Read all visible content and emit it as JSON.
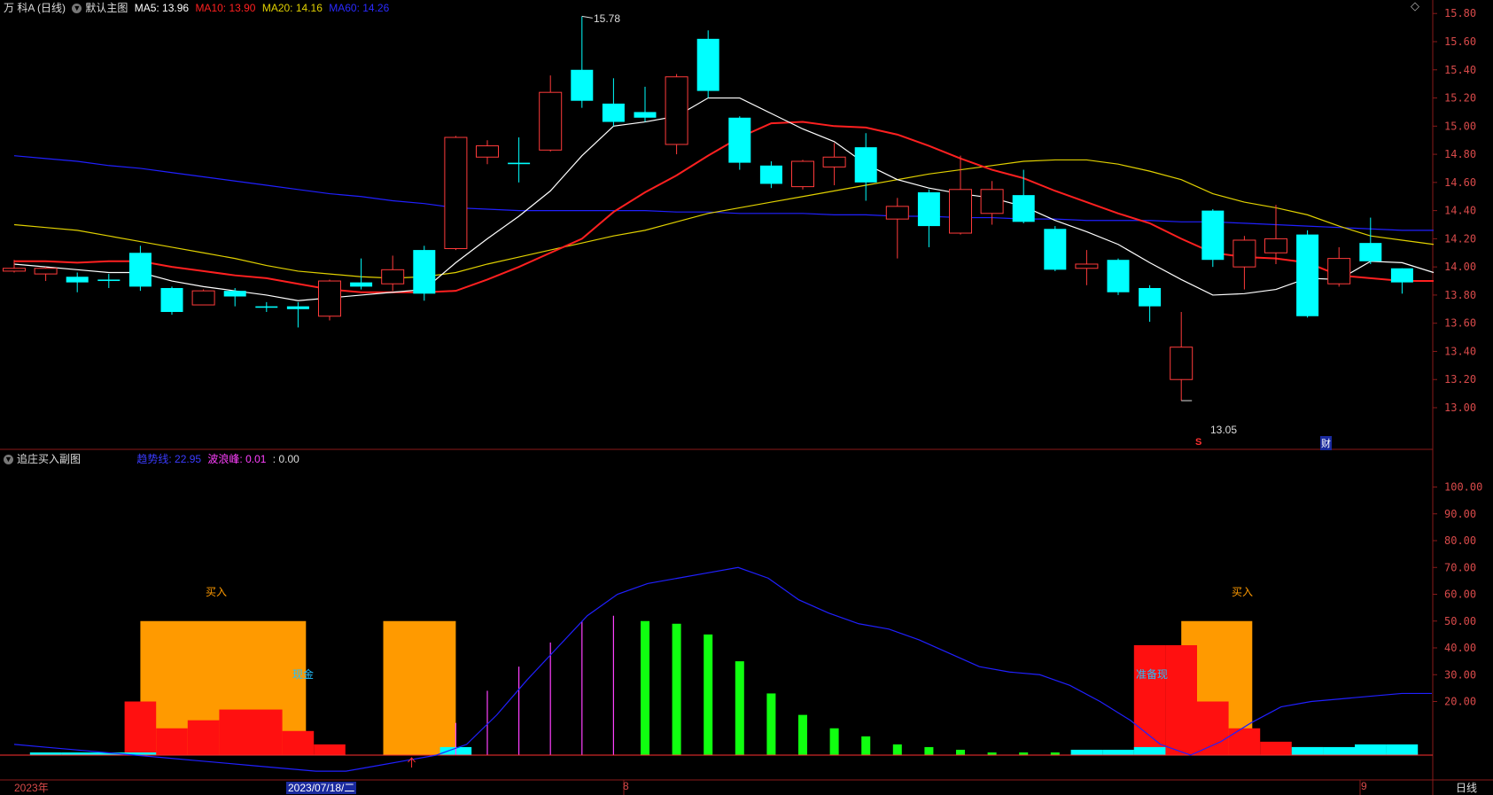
{
  "main": {
    "stock": "万 科A (日线)",
    "template": "默认主图",
    "ma5_label": "MA5: 13.96",
    "ma10_label": "MA10: 13.90",
    "ma20_label": "MA20: 14.16",
    "ma60_label": "MA60: 14.26",
    "high_mark": "15.78",
    "low_mark": "13.05",
    "marker_s": "S",
    "marker_cai": "财",
    "diamond": "◇",
    "y_ticks": [
      "15.80",
      "15.60",
      "15.40",
      "15.20",
      "15.00",
      "14.80",
      "14.60",
      "14.40",
      "14.20",
      "14.00",
      "13.80",
      "13.60",
      "13.40",
      "13.20",
      "13.00"
    ]
  },
  "sub": {
    "title": "追庄买入副图",
    "ind1": "趋势线: 22.95",
    "ind2": "波浪峰: 0.01",
    "ind3": ": 0.00",
    "buy1": "买入",
    "buy2": "买入",
    "cash1": "现金",
    "cash2": "准备现",
    "y_ticks": [
      "100.00",
      "90.00",
      "80.00",
      "70.00",
      "60.00",
      "50.00",
      "40.00",
      "30.00",
      "20.00"
    ]
  },
  "axis": {
    "year": "2023年",
    "date": "2023/07/18/二",
    "m8": "8",
    "m9": "9",
    "period": "日线"
  },
  "colors": {
    "up": "#ff3b3b",
    "down": "#00ffff",
    "bg": "#000000",
    "ma5": "#ffffff",
    "ma10": "#ff2020",
    "ma20": "#e0d000",
    "ma60": "#2020ff"
  },
  "chart_data": {
    "type": "candlestick",
    "candles": [
      {
        "o": 13.97,
        "c": 13.99,
        "h": 14.05,
        "l": 13.96
      },
      {
        "o": 13.95,
        "c": 13.99,
        "h": 14.0,
        "l": 13.9
      },
      {
        "o": 13.93,
        "c": 13.89,
        "h": 13.96,
        "l": 13.82
      },
      {
        "o": 13.91,
        "c": 13.9,
        "h": 13.95,
        "l": 13.85
      },
      {
        "o": 14.1,
        "c": 13.86,
        "h": 14.15,
        "l": 13.83
      },
      {
        "o": 13.85,
        "c": 13.68,
        "h": 13.86,
        "l": 13.66
      },
      {
        "o": 13.73,
        "c": 13.83,
        "h": 13.84,
        "l": 13.73
      },
      {
        "o": 13.83,
        "c": 13.79,
        "h": 13.85,
        "l": 13.72
      },
      {
        "o": 13.72,
        "c": 13.71,
        "h": 13.75,
        "l": 13.68
      },
      {
        "o": 13.72,
        "c": 13.7,
        "h": 13.75,
        "l": 13.57
      },
      {
        "o": 13.65,
        "c": 13.9,
        "h": 13.91,
        "l": 13.62
      },
      {
        "o": 13.89,
        "c": 13.86,
        "h": 14.06,
        "l": 13.84
      },
      {
        "o": 13.88,
        "c": 13.98,
        "h": 14.08,
        "l": 13.83
      },
      {
        "o": 14.12,
        "c": 13.81,
        "h": 14.15,
        "l": 13.76
      },
      {
        "o": 14.13,
        "c": 14.92,
        "h": 14.93,
        "l": 14.12
      },
      {
        "o": 14.78,
        "c": 14.86,
        "h": 14.9,
        "l": 14.73
      },
      {
        "o": 14.74,
        "c": 14.73,
        "h": 14.92,
        "l": 14.6
      },
      {
        "o": 14.83,
        "c": 15.24,
        "h": 15.36,
        "l": 14.82
      },
      {
        "o": 15.4,
        "c": 15.18,
        "h": 15.78,
        "l": 15.13
      },
      {
        "o": 15.16,
        "c": 15.03,
        "h": 15.34,
        "l": 15.0
      },
      {
        "o": 15.1,
        "c": 15.06,
        "h": 15.28,
        "l": 15.03
      },
      {
        "o": 14.87,
        "c": 15.35,
        "h": 15.37,
        "l": 14.8
      },
      {
        "o": 15.62,
        "c": 15.25,
        "h": 15.68,
        "l": 15.2
      },
      {
        "o": 15.06,
        "c": 14.74,
        "h": 15.07,
        "l": 14.69
      },
      {
        "o": 14.72,
        "c": 14.59,
        "h": 14.75,
        "l": 14.56
      },
      {
        "o": 14.57,
        "c": 14.75,
        "h": 14.76,
        "l": 14.55
      },
      {
        "o": 14.71,
        "c": 14.78,
        "h": 14.88,
        "l": 14.58
      },
      {
        "o": 14.85,
        "c": 14.6,
        "h": 14.95,
        "l": 14.47
      },
      {
        "o": 14.34,
        "c": 14.43,
        "h": 14.49,
        "l": 14.06
      },
      {
        "o": 14.53,
        "c": 14.29,
        "h": 14.55,
        "l": 14.14
      },
      {
        "o": 14.24,
        "c": 14.55,
        "h": 14.79,
        "l": 14.23
      },
      {
        "o": 14.38,
        "c": 14.55,
        "h": 14.61,
        "l": 14.3
      },
      {
        "o": 14.51,
        "c": 14.32,
        "h": 14.69,
        "l": 14.31
      },
      {
        "o": 14.27,
        "c": 13.98,
        "h": 14.29,
        "l": 13.97
      },
      {
        "o": 13.99,
        "c": 14.02,
        "h": 14.12,
        "l": 13.87
      },
      {
        "o": 14.05,
        "c": 13.82,
        "h": 14.06,
        "l": 13.8
      },
      {
        "o": 13.85,
        "c": 13.72,
        "h": 13.87,
        "l": 13.61
      },
      {
        "o": 13.2,
        "c": 13.43,
        "h": 13.68,
        "l": 13.05
      },
      {
        "o": 14.4,
        "c": 14.05,
        "h": 14.41,
        "l": 14.0
      },
      {
        "o": 14.0,
        "c": 14.19,
        "h": 14.22,
        "l": 13.84
      },
      {
        "o": 14.1,
        "c": 14.2,
        "h": 14.44,
        "l": 14.02
      },
      {
        "o": 14.23,
        "c": 13.65,
        "h": 14.26,
        "l": 13.64
      },
      {
        "o": 13.88,
        "c": 14.06,
        "h": 14.14,
        "l": 13.86
      },
      {
        "o": 14.17,
        "c": 14.04,
        "h": 14.35,
        "l": 14.02
      },
      {
        "o": 13.99,
        "c": 13.89,
        "h": 13.99,
        "l": 13.81
      }
    ],
    "ma5": [
      14.02,
      14.0,
      13.98,
      13.96,
      13.96,
      13.9,
      13.86,
      13.83,
      13.8,
      13.76,
      13.78,
      13.8,
      13.82,
      13.84,
      14.03,
      14.2,
      14.36,
      14.54,
      14.79,
      15.0,
      15.03,
      15.07,
      15.2,
      15.2,
      15.09,
      14.98,
      14.89,
      14.73,
      14.62,
      14.56,
      14.52,
      14.49,
      14.43,
      14.33,
      14.25,
      14.16,
      14.03,
      13.91,
      13.8,
      13.81,
      13.84,
      13.92,
      13.91,
      14.04,
      14.03,
      13.96
    ],
    "ma10": [
      14.04,
      14.04,
      14.03,
      14.04,
      14.04,
      14.0,
      13.97,
      13.94,
      13.92,
      13.88,
      13.84,
      13.82,
      13.82,
      13.82,
      13.83,
      13.91,
      14.0,
      14.1,
      14.2,
      14.39,
      14.53,
      14.65,
      14.79,
      14.92,
      15.02,
      15.03,
      15.0,
      14.99,
      14.94,
      14.86,
      14.77,
      14.69,
      14.63,
      14.54,
      14.46,
      14.38,
      14.31,
      14.2,
      14.1,
      14.07,
      14.06,
      14.03,
      13.94,
      13.92,
      13.9,
      13.9
    ],
    "ma20": [
      14.3,
      14.28,
      14.26,
      14.22,
      14.18,
      14.14,
      14.1,
      14.06,
      14.01,
      13.97,
      13.95,
      13.93,
      13.92,
      13.93,
      13.96,
      14.02,
      14.07,
      14.12,
      14.17,
      14.22,
      14.26,
      14.32,
      14.38,
      14.42,
      14.46,
      14.5,
      14.54,
      14.58,
      14.62,
      14.66,
      14.69,
      14.72,
      14.75,
      14.76,
      14.76,
      14.73,
      14.68,
      14.62,
      14.52,
      14.46,
      14.42,
      14.37,
      14.29,
      14.22,
      14.19,
      14.16
    ],
    "ma60": [
      14.79,
      14.77,
      14.75,
      14.72,
      14.7,
      14.67,
      14.64,
      14.61,
      14.58,
      14.55,
      14.52,
      14.5,
      14.47,
      14.45,
      14.42,
      14.41,
      14.4,
      14.4,
      14.4,
      14.4,
      14.4,
      14.39,
      14.39,
      14.38,
      14.38,
      14.38,
      14.37,
      14.37,
      14.36,
      14.36,
      14.35,
      14.35,
      14.34,
      14.34,
      14.33,
      14.33,
      14.33,
      14.32,
      14.32,
      14.31,
      14.3,
      14.29,
      14.28,
      14.27,
      14.26,
      14.26
    ],
    "sub_orange": [
      {
        "from": 4.5,
        "to": 8.75,
        "v": 50
      },
      {
        "from": 12.2,
        "to": 13.5,
        "v": 50
      },
      {
        "from": 37.5,
        "to": 38.75,
        "v": 50
      }
    ],
    "sub_red": [
      0,
      0,
      0,
      0,
      20,
      10,
      13,
      17,
      17,
      9,
      4,
      0,
      0,
      0,
      0,
      0,
      0,
      0,
      0,
      0,
      0,
      0,
      0,
      0,
      0,
      0,
      0,
      0,
      0,
      0,
      0,
      0,
      0,
      0,
      0,
      0,
      41,
      41,
      20,
      10,
      5,
      3,
      2,
      1,
      1
    ],
    "sub_cyan": [
      0,
      1,
      1,
      1,
      1,
      0,
      0,
      0,
      0,
      0,
      0,
      0,
      0,
      0,
      3,
      0,
      0,
      0,
      0,
      0,
      0,
      0,
      0,
      0,
      0,
      0,
      0,
      0,
      0,
      0,
      0,
      0,
      0,
      0,
      2,
      2,
      3,
      0,
      0,
      0,
      0,
      3,
      3,
      4,
      4
    ],
    "sub_magenta": [
      0,
      0,
      0,
      0,
      0,
      0,
      0,
      0,
      0,
      0,
      0,
      0,
      0,
      0,
      12,
      24,
      33,
      42,
      50,
      52,
      0,
      0,
      0,
      0,
      0,
      0,
      0,
      0,
      0,
      0,
      0,
      0,
      0,
      0,
      0,
      0,
      0,
      0,
      0,
      0,
      0,
      0,
      0,
      0,
      0
    ],
    "sub_green": [
      0,
      0,
      0,
      0,
      0,
      0,
      0,
      0,
      0,
      0,
      0,
      0,
      0,
      0,
      0,
      0,
      0,
      0,
      0,
      0,
      50,
      49,
      45,
      35,
      23,
      15,
      10,
      7,
      4,
      3,
      2,
      1,
      1,
      1,
      0,
      0,
      0,
      0,
      0,
      0,
      0,
      0,
      0,
      0,
      0
    ],
    "sub_line": [
      4,
      3,
      2,
      1,
      0,
      -1,
      -2,
      -3,
      -4,
      -5,
      -6,
      -6,
      -4,
      -2,
      0,
      4,
      15,
      28,
      40,
      52,
      60,
      64,
      66,
      68,
      70,
      66,
      58,
      53,
      49,
      47,
      43,
      38,
      33,
      31,
      30,
      26,
      20,
      13,
      4,
      0,
      5,
      12,
      18,
      20,
      21,
      22,
      23,
      23
    ]
  }
}
